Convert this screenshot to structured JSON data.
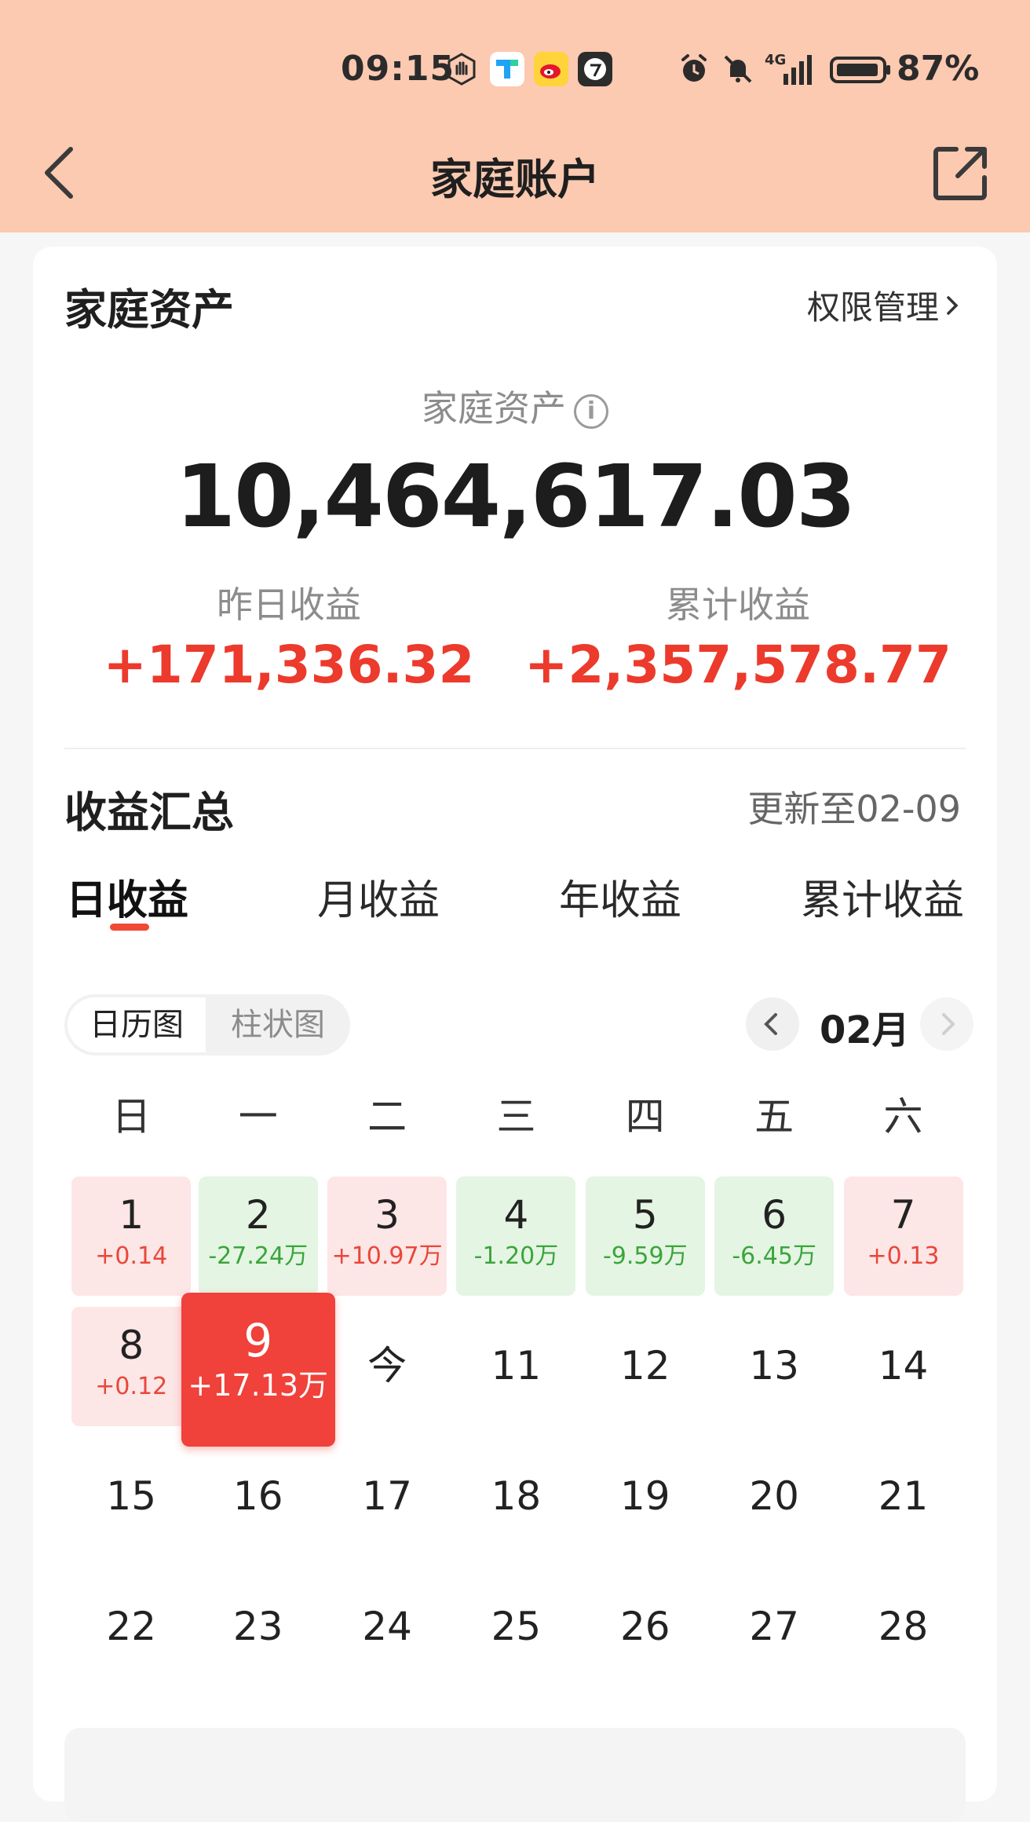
{
  "status_bar": {
    "time": "09:15",
    "battery": "87%",
    "signal": "4G",
    "icons": [
      "hand-icon",
      "tencent-icon",
      "weibo-icon",
      "app-icon",
      "alarm-icon",
      "mute-icon",
      "signal-icon",
      "battery-icon"
    ]
  },
  "nav": {
    "title": "家庭账户"
  },
  "assets": {
    "section_title": "家庭资产",
    "permission_link": "权限管理",
    "label": "家庭资产",
    "value": "10,464,617.03",
    "yesterday_label": "昨日收益",
    "yesterday_value": "+171,336.32",
    "total_label": "累计收益",
    "total_value": "+2,357,578.77"
  },
  "earnings": {
    "section_title": "收益汇总",
    "updated": "更新至02-09",
    "tabs": [
      {
        "label": "日收益",
        "active": true
      },
      {
        "label": "月收益",
        "active": false
      },
      {
        "label": "年收益",
        "active": false
      },
      {
        "label": "累计收益",
        "active": false
      }
    ],
    "view_toggle": {
      "calendar": "日历图",
      "bar": "柱状图",
      "selected": "日历图"
    },
    "month": "02月",
    "weekdays": [
      "日",
      "一",
      "二",
      "三",
      "四",
      "五",
      "六"
    ],
    "days": [
      {
        "num": "1",
        "val": "+0.14",
        "kind": "pos"
      },
      {
        "num": "2",
        "val": "-27.24万",
        "kind": "neg"
      },
      {
        "num": "3",
        "val": "+10.97万",
        "kind": "pos"
      },
      {
        "num": "4",
        "val": "-1.20万",
        "kind": "neg"
      },
      {
        "num": "5",
        "val": "-9.59万",
        "kind": "neg"
      },
      {
        "num": "6",
        "val": "-6.45万",
        "kind": "neg"
      },
      {
        "num": "7",
        "val": "+0.13",
        "kind": "pos"
      },
      {
        "num": "8",
        "val": "+0.12",
        "kind": "pos"
      },
      {
        "num": "9",
        "val": "+17.13万",
        "kind": "sel"
      },
      {
        "num": "今",
        "val": "",
        "kind": "plain"
      },
      {
        "num": "11",
        "val": "",
        "kind": "plain"
      },
      {
        "num": "12",
        "val": "",
        "kind": "plain"
      },
      {
        "num": "13",
        "val": "",
        "kind": "plain"
      },
      {
        "num": "14",
        "val": "",
        "kind": "plain"
      },
      {
        "num": "15",
        "val": "",
        "kind": "plain"
      },
      {
        "num": "16",
        "val": "",
        "kind": "plain"
      },
      {
        "num": "17",
        "val": "",
        "kind": "plain"
      },
      {
        "num": "18",
        "val": "",
        "kind": "plain"
      },
      {
        "num": "19",
        "val": "",
        "kind": "plain"
      },
      {
        "num": "20",
        "val": "",
        "kind": "plain"
      },
      {
        "num": "21",
        "val": "",
        "kind": "plain"
      },
      {
        "num": "22",
        "val": "",
        "kind": "plain"
      },
      {
        "num": "23",
        "val": "",
        "kind": "plain"
      },
      {
        "num": "24",
        "val": "",
        "kind": "plain"
      },
      {
        "num": "25",
        "val": "",
        "kind": "plain"
      },
      {
        "num": "26",
        "val": "",
        "kind": "plain"
      },
      {
        "num": "27",
        "val": "",
        "kind": "plain"
      },
      {
        "num": "28",
        "val": "",
        "kind": "plain"
      }
    ]
  },
  "colors": {
    "header_bg": "#fcc9b1",
    "accent_red": "#ec3a2c",
    "gain_bg": "#fce6e6",
    "loss_bg": "#e4f5e3",
    "loss_text": "#3ba53b",
    "selected_bg": "#f0413a"
  }
}
